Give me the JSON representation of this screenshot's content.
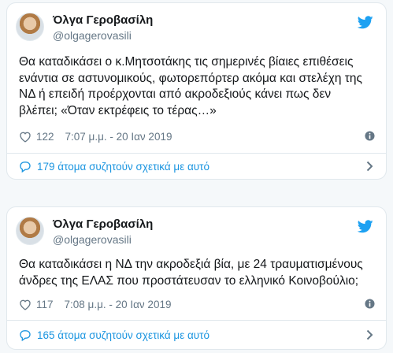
{
  "tweets": [
    {
      "author_name": "Όλγα Γεροβασίλη",
      "handle": "@olgagerovasili",
      "text_lines": [
        "Θα καταδικάσει ο κ.Μητσοτάκης τις σημερινές βίαιες επιθέσεις",
        "ενάντια σε αστυνομικούς, φωτορεπόρτερ ακόμα και στελέχη της",
        "ΝΔ ή  επειδή προέρχονται από ακροδεξιούς κάνει πως δεν",
        "βλέπει; «Όταν εκτρέφεις το τέρας…»"
      ],
      "likes": "122",
      "timestamp": "7:07 μ.μ. - 20 Ιαν 2019",
      "conversation_label": "179 άτομα συζητούν σχετικά με αυτό"
    },
    {
      "author_name": "Όλγα Γεροβασίλη",
      "handle": "@olgagerovasili",
      "text_lines": [
        "Θα καταδικάσει η ΝΔ την ακροδεξιά βία, με 24 τραυματισμένους",
        "άνδρες της ΕΛΑΣ που προστάτευσαν το ελληνικό Κοινοβούλιο;"
      ],
      "likes": "117",
      "timestamp": "7:08 μ.μ. - 20 Ιαν 2019",
      "conversation_label": "165 άτομα συζητούν σχετικά με αυτό"
    }
  ],
  "icons": {
    "brand": "twitter-bird-icon",
    "like": "heart-icon",
    "info": "info-icon",
    "conversation": "speech-bubble-icon",
    "chevron": "chevron-right-icon"
  },
  "colors": {
    "accent": "#1b95e0",
    "brand": "#1da1f2",
    "secondary_text": "#657786",
    "border": "#e1e8ed",
    "background": "#f5f8fa"
  }
}
